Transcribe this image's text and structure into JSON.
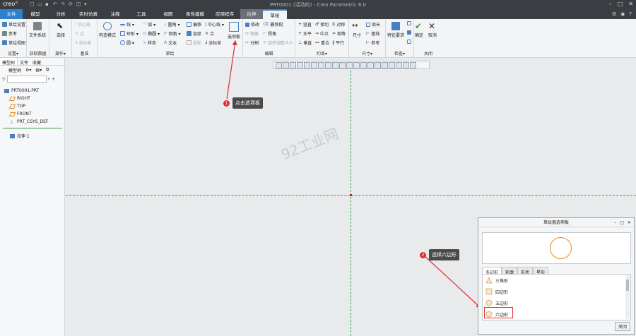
{
  "titlebar": {
    "logo": "creo°",
    "title": "PRT0001 (活动的) - Creo Parametric 6.0"
  },
  "tabs": {
    "file": "文件",
    "items": [
      "模型",
      "分析",
      "实时仿真",
      "注释",
      "工具",
      "视图",
      "柔性建模",
      "应用程序"
    ],
    "context": "拉伸",
    "active": "草绘"
  },
  "ribbon": {
    "setup": {
      "items": [
        "草绘设置",
        "参考",
        "草绘视图"
      ],
      "label": "设置▾"
    },
    "data": {
      "button": "文件系统",
      "label": "获取数据"
    },
    "ops": {
      "select": "选择",
      "label": "操作▾"
    },
    "datum": {
      "items": [
        "中心线",
        "点",
        "坐标系"
      ],
      "label": "基准"
    },
    "sketch": {
      "construct": "构造模式",
      "col1": [
        "线 ▾",
        "矩形 ▾",
        "圆 ▾"
      ],
      "col2": [
        "弧 ▾",
        "椭圆 ▾",
        "样条"
      ],
      "col3": [
        "圆角 ▾",
        "倒角 ▾",
        "文本"
      ],
      "col4": [
        "偏移",
        "加厚",
        "投影"
      ],
      "col5": [
        "中心线 ▾",
        "点",
        "坐标系"
      ],
      "palette": "选项板",
      "label": "草绘"
    },
    "edit": {
      "items": [
        "修改",
        "镜像",
        "分割"
      ],
      "items2": [
        "删除段",
        "拐角",
        "旋转调整大小"
      ],
      "label": "编辑"
    },
    "constrain": {
      "col1": [
        "竖直",
        "水平",
        "垂直"
      ],
      "col2": [
        "相切",
        "中点",
        "重合"
      ],
      "col3": [
        "对称",
        "相等",
        "平行"
      ],
      "label": "约束▾"
    },
    "dimension": {
      "main": "尺寸",
      "items": [
        "周长",
        "基线",
        "参考"
      ],
      "label": "尺寸▾"
    },
    "inspect": {
      "main": "特征要求",
      "label": "检查▾"
    },
    "close": {
      "ok": "确定",
      "cancel": "取消",
      "label": "关闭"
    }
  },
  "left_panel": {
    "tabs": [
      "模型树",
      "文件",
      "收藏"
    ],
    "tools_label": "模型树",
    "tree": [
      "PRT0001.PRT",
      "RIGHT",
      "TOP",
      "FRONT",
      "PRT_CSYS_DEF",
      "拉伸 1"
    ]
  },
  "callouts": [
    {
      "num": "1",
      "text": "点击选项板"
    },
    {
      "num": "2",
      "text": "选择六边形"
    }
  ],
  "watermark": "92工业网",
  "palette": {
    "title": "草绘器选项板",
    "tabs": [
      "多边形",
      "轮廓",
      "形状",
      "星形"
    ],
    "items": [
      "三角形",
      "四边形",
      "五边形",
      "六边形"
    ],
    "close": "关闭"
  },
  "colors": {
    "accent": "#2f7fd0",
    "callout": "#d93030",
    "construction_line": "#2ba24c",
    "preview_circle": "#e38b1a"
  }
}
